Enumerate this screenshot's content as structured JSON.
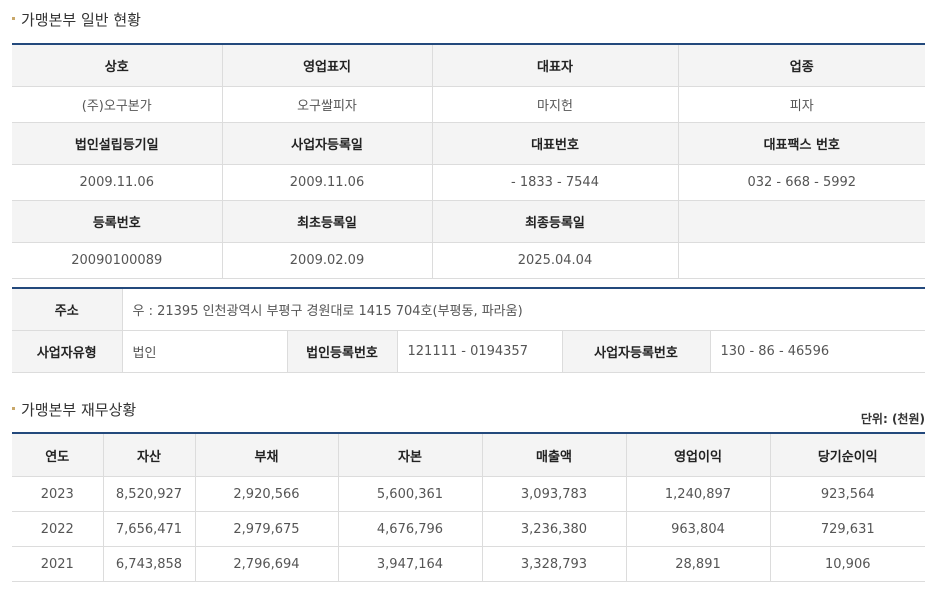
{
  "general": {
    "title": "가맹본부 일반 현황",
    "row1_headers": [
      "상호",
      "영업표지",
      "대표자",
      "업종"
    ],
    "row1_values": [
      "(주)오구본가",
      "오구쌀피자",
      "마지헌",
      "피자"
    ],
    "row2_headers": [
      "법인설립등기일",
      "사업자등록일",
      "대표번호",
      "대표팩스 번호"
    ],
    "row2_values": [
      "2009.11.06",
      "2009.11.06",
      "- 1833 - 7544",
      "032 - 668 - 5992"
    ],
    "row3_headers": [
      "등록번호",
      "최초등록일",
      "최종등록일",
      ""
    ],
    "row3_values": [
      "20090100089",
      "2009.02.09",
      "2025.04.04",
      ""
    ]
  },
  "address": {
    "address_label": "주소",
    "address_value": "우 : 21395 인천광역시 부평구 경원대로 1415 704호(부평동, 파라움)",
    "biz_type_label": "사업자유형",
    "biz_type_value": "법인",
    "corp_reg_label": "법인등록번호",
    "corp_reg_value": "121111 - 0194357",
    "biz_reg_label": "사업자등록번호",
    "biz_reg_value": "130 - 86 - 46596"
  },
  "finance": {
    "title": "가맹본부 재무상황",
    "unit": "단위: (천원)",
    "headers": [
      "연도",
      "자산",
      "부채",
      "자본",
      "매출액",
      "영업이익",
      "당기순이익"
    ],
    "rows": [
      [
        "2023",
        "8,520,927",
        "2,920,566",
        "5,600,361",
        "3,093,783",
        "1,240,897",
        "923,564"
      ],
      [
        "2022",
        "7,656,471",
        "2,979,675",
        "4,676,796",
        "3,236,380",
        "963,804",
        "729,631"
      ],
      [
        "2021",
        "6,743,858",
        "2,796,694",
        "3,947,164",
        "3,328,793",
        "28,891",
        "10,906"
      ]
    ]
  }
}
